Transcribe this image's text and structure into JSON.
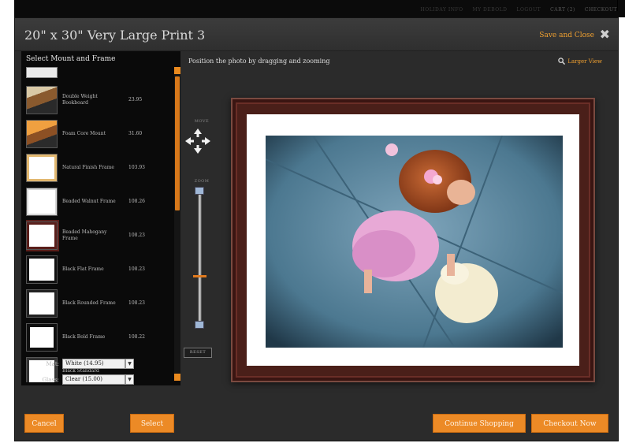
{
  "header": {
    "title": "20\" x 30\" Very Large Print 3",
    "save_close_label": "Save and Close",
    "close_icon": "close-icon"
  },
  "top_nav": {
    "items": [
      "HOLIDAY INFO",
      "MY DEBOLD",
      "LOGOUT",
      "CART (2)",
      "CHECKOUT"
    ]
  },
  "sidebar": {
    "heading": "Select Mount and Frame",
    "items": [
      {
        "name": "Double Weight Bookboard",
        "price": "23.95",
        "thumb": "board"
      },
      {
        "name": "Foam Core Mount",
        "price": "31.60",
        "thumb": "foam"
      },
      {
        "name": "Natural Finish Frame",
        "price": "103.93",
        "thumb": "natural"
      },
      {
        "name": "Beaded Walnut Frame",
        "price": "108.26",
        "thumb": "walnut"
      },
      {
        "name": "Beaded Mahogany Frame",
        "price": "108.23",
        "thumb": "mahogany"
      },
      {
        "name": "Black Flat Frame",
        "price": "108.23",
        "thumb": "black-flat"
      },
      {
        "name": "Black Rounded Frame",
        "price": "108.23",
        "thumb": "black-rounded"
      },
      {
        "name": "Black Bold Frame",
        "price": "108.22",
        "thumb": "black-bold"
      },
      {
        "name": "Black Standard",
        "price": "",
        "thumb": "partial"
      }
    ],
    "mat_label": "Mat:",
    "mat_value": "White (14.95)",
    "glass_label": "Glass:",
    "glass_value": "Clear (15.00)",
    "cancel_label": "Cancel",
    "select_label": "Select"
  },
  "main": {
    "instruction": "Position the photo by dragging and zooming",
    "larger_view_label": "Larger View",
    "move_label": "MOVE",
    "zoom_label": "ZOOM",
    "zoom_level": 0.35,
    "reset_label": "RESET"
  },
  "footer": {
    "continue_label": "Continue Shopping",
    "checkout_label": "Checkout Now"
  },
  "colors": {
    "accent": "#ec8a26",
    "frame": "#4a1f19",
    "dialog_bg": "#2b2b2b",
    "sidebar_bg": "#0a0a0a"
  }
}
